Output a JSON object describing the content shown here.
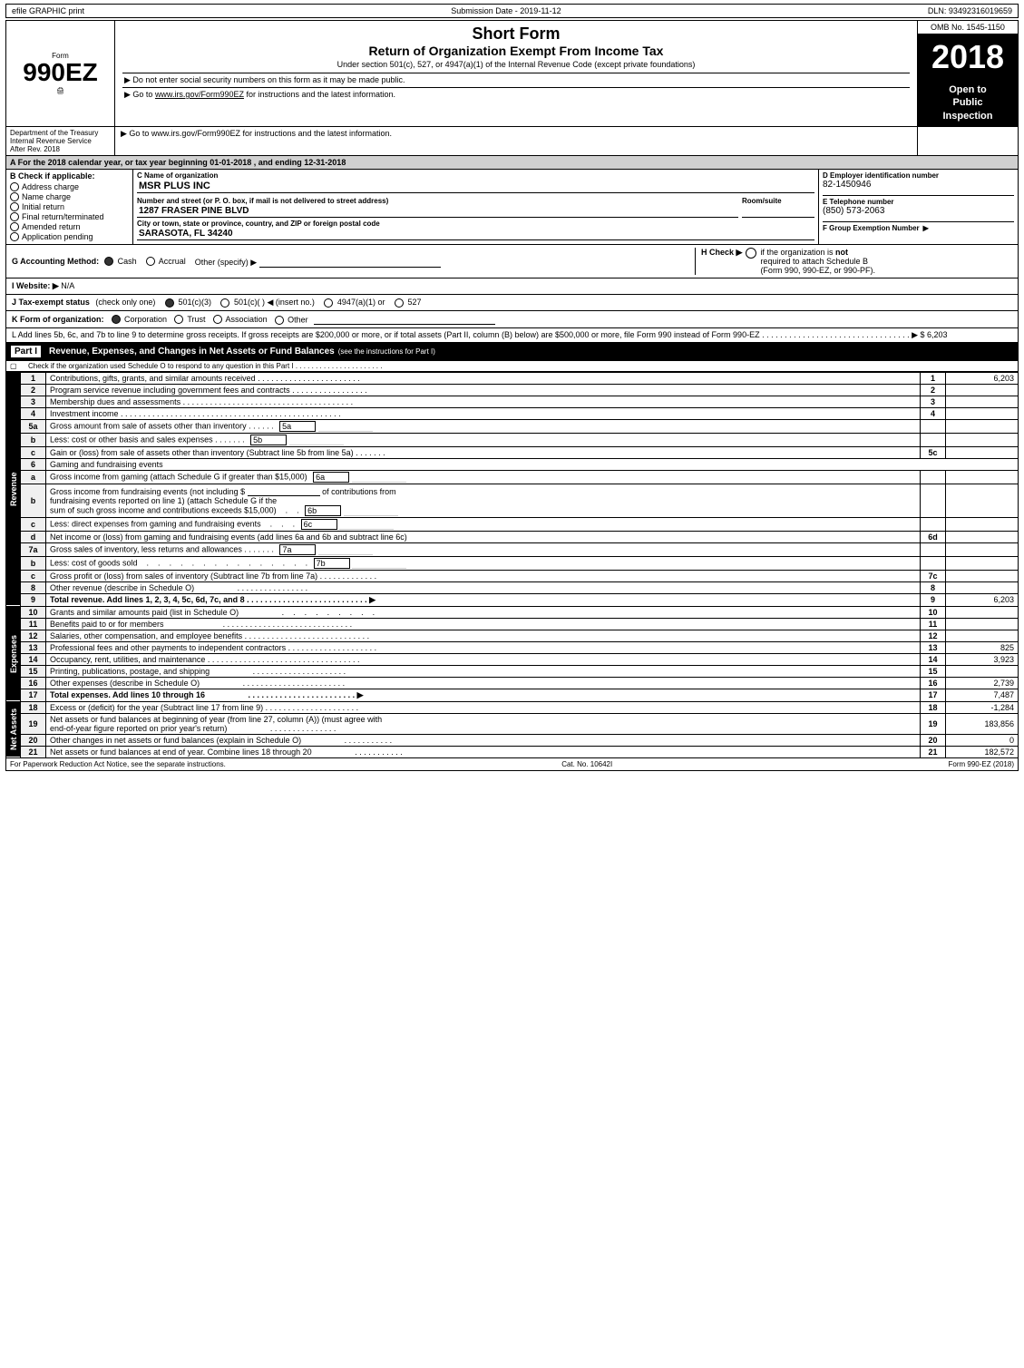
{
  "topBar": {
    "left": "efile GRAPHIC print",
    "middle": "Submission Date - 2019-11-12",
    "right": "DLN: 93492316019659"
  },
  "header": {
    "formLabel": "Form",
    "formNumber": "990EZ",
    "shortFormTitle": "Short Form",
    "returnTitle": "Return of Organization Exempt From Income Tax",
    "subtitle": "Under section 501(c), 527, or 4947(a)(1) of the Internal Revenue Code (except private foundations)",
    "publicNotice": "▶ Do not enter social security numbers on this form as it may be made public.",
    "instructions": "▶ Go to www.irs.gov/Form990EZ for instructions and the latest information.",
    "year": "2018",
    "openToPublic": [
      "Open to",
      "Public",
      "Inspection"
    ],
    "ombNumber": "OMB No. 1545-1150"
  },
  "department": {
    "name": "Department of the Treasury",
    "afterRevDate": "After Rev. 2018",
    "websiteNote": "▶ Go to www.irs.gov/Form990EZ for instructions and the latest information."
  },
  "yearLine": {
    "text": "A For the 2018 calendar year, or tax year beginning 01-01-2018        , and ending 12-31-2018"
  },
  "checkSection": {
    "label": "B Check if applicable:",
    "items": [
      {
        "id": "address",
        "label": "Address charge",
        "checked": false
      },
      {
        "id": "name",
        "label": "Name charge",
        "checked": false
      },
      {
        "id": "initial",
        "label": "Initial return",
        "checked": false
      },
      {
        "id": "final",
        "label": "Final return/terminated",
        "checked": false
      },
      {
        "id": "amended",
        "label": "Amended return",
        "checked": false
      },
      {
        "id": "pending",
        "label": "Application pending",
        "checked": false
      }
    ],
    "cLabel": "C Name of organization",
    "orgName": "MSR PLUS INC",
    "addressLabel": "Number and street (or P. O. box, if mail is not delivered to street address)",
    "addressValue": "1287 FRASER PINE BLVD",
    "roomSuiteLabel": "Room/suite",
    "cityLabel": "City or town, state or province, country, and ZIP or foreign postal code",
    "cityValue": "SARASOTA, FL  34240",
    "dLabel": "D Employer identification number",
    "ein": "82-1450946",
    "eLabel": "E Telephone number",
    "phone": "(850) 573-2063",
    "fLabel": "F Group Exemption Number",
    "fArrow": "▶"
  },
  "accountingMethod": {
    "label": "G Accounting Method:",
    "cash": "Cash",
    "accrual": "Accrual",
    "other": "Other (specify) ▶",
    "cashSelected": true,
    "hLabel": "H Check ▶",
    "hText1": "if the organization is",
    "hBold": "not",
    "hText2": "required to attach Schedule B",
    "hText3": "(Form 990, 990-EZ, or 990-PF)."
  },
  "website": {
    "label": "I Website: ▶",
    "value": "N/A"
  },
  "taxStatus": {
    "label": "J Tax-exempt status",
    "note": "(check only one)",
    "options": [
      {
        "value": "501(c)(3)",
        "selected": true
      },
      {
        "value": "501(c)(  )",
        "selected": false,
        "insertNo": "(insert no.)"
      },
      {
        "value": "4947(a)(1) or",
        "selected": false
      },
      {
        "value": "527",
        "selected": false
      }
    ]
  },
  "formOrg": {
    "label": "K Form of organization:",
    "options": [
      {
        "value": "Corporation",
        "selected": true
      },
      {
        "value": "Trust",
        "selected": false
      },
      {
        "value": "Association",
        "selected": false
      },
      {
        "value": "Other",
        "selected": false
      }
    ]
  },
  "lText": "L Add lines 5b, 6c, and 7b to line 9 to determine gross receipts. If gross receipts are $200,000 or more, or if total assets (Part II, column (B) below) are $500,000 or more, file Form 990 instead of Form 990-EZ . . . . . . . . . . . . . . . . . . . . . . . . . . . . . . . . . ▶ $ 6,203",
  "partI": {
    "label": "Part I",
    "title": "Revenue, Expenses, and Changes in Net Assets or Fund Balances",
    "titleNote": "(see the instructions for Part I)",
    "schedCheckText": "Check if the organization used Schedule O to respond to any question in this Part I . . . . . . . . . . . . . . . . . . . . . .",
    "schedCheckBox": "▢",
    "rows": [
      {
        "num": "1",
        "desc": "Contributions, gifts, grants, and similar amounts received . . . . . . . . . . . . . . . . . . . . . . .",
        "lineNum": "1",
        "amount": "6,203"
      },
      {
        "num": "2",
        "desc": "Program service revenue including government fees and contracts . . . . . . . . . . . . . . . . .",
        "lineNum": "2",
        "amount": ""
      },
      {
        "num": "3",
        "desc": "Membership dues and assessments . . . . . . . . . . . . . . . . . . . . . . . . . . . . . . . . . . . . . .",
        "lineNum": "3",
        "amount": ""
      },
      {
        "num": "4",
        "desc": "Investment income . . . . . . . . . . . . . . . . . . . . . . . . . . . . . . . . . . . . . . . . . . . . . . . . .",
        "lineNum": "4",
        "amount": ""
      },
      {
        "num": "5a",
        "desc": "Gross amount from sale of assets other than inventory . . . . . .",
        "lineNum": "5a",
        "amount": "",
        "hasInlineBox": true
      },
      {
        "num": "5b",
        "desc": "Less: cost or other basis and sales expenses . . . . . . . .",
        "lineNum": "5b",
        "amount": "",
        "hasInlineBox": true
      },
      {
        "num": "5c",
        "desc": "Gain or (loss) from sale of assets other than inventory (Subtract line 5b from line 5a) . . . . . . .",
        "lineNum": "5c",
        "amount": ""
      },
      {
        "num": "6",
        "desc": "Gaming and fundraising events",
        "lineNum": "",
        "amount": "",
        "noAmount": true
      },
      {
        "num": "6a",
        "desc": "Gross income from gaming (attach Schedule G if greater than $15,000)",
        "lineNum": "6a",
        "amount": "",
        "hasInlineBox": true
      },
      {
        "num": "6b",
        "desc": "Gross income from fundraising events (not including $ ______________ of contributions from fundraising events reported on line 1) (attach Schedule G if the sum of such gross income and contributions exceeds $15,000)     .     .",
        "lineNum": "6b",
        "amount": "",
        "hasInlineBox": true
      },
      {
        "num": "6c",
        "desc": "Less: direct expenses from gaming and fundraising events     .     .     .",
        "lineNum": "6c",
        "amount": "",
        "hasInlineBox": true
      },
      {
        "num": "6d",
        "desc": "Net income or (loss) from gaming and fundraising events (add lines 6a and 6b and subtract line 6c)",
        "lineNum": "6d",
        "amount": ""
      },
      {
        "num": "7a",
        "desc": "Gross sales of inventory, less returns and allowances . . . . . . . .",
        "lineNum": "7a",
        "amount": "",
        "hasInlineBox": true
      },
      {
        "num": "7b",
        "desc": "Less: cost of goods sold     .     .     .     .     .     .     .     .     .     .     .     .     .     .     .",
        "lineNum": "7b",
        "amount": "",
        "hasInlineBox": true
      },
      {
        "num": "7c",
        "desc": "Gross profit or (loss) from sales of inventory (Subtract line 7b from line 7a) . . . . . . . . . . . . .",
        "lineNum": "7c",
        "amount": ""
      },
      {
        "num": "8",
        "desc": "Other revenue (describe in Schedule O)                               . . . . . . . . . . . . . . . .",
        "lineNum": "8",
        "amount": ""
      },
      {
        "num": "9",
        "desc": "Total revenue. Add lines 1, 2, 3, 4, 5c, 6d, 7c, and 8 . . . . . . . . . . . . . . . . . . . . . . . . . . ▶",
        "lineNum": "9",
        "amount": "6,203",
        "bold": true
      }
    ],
    "expenseRows": [
      {
        "num": "10",
        "desc": "Grants and similar amounts paid (list in Schedule O)                               .     .     .     .     .     .     .     .     .     .",
        "lineNum": "10",
        "amount": ""
      },
      {
        "num": "11",
        "desc": "Benefits paid to or for members                               . . . . . . . . . . . . . . . . . . . . . . . . . . . . .",
        "lineNum": "11",
        "amount": ""
      },
      {
        "num": "12",
        "desc": "Salaries, other compensation, and employee benefits . . . . . . . . . . . . . . . . . . . . . . . . . . . .",
        "lineNum": "12",
        "amount": ""
      },
      {
        "num": "13",
        "desc": "Professional fees and other payments to independent contractors . . . . . . . . . . . . . . . . . . . .",
        "lineNum": "13",
        "amount": "825"
      },
      {
        "num": "14",
        "desc": "Occupancy, rent, utilities, and maintenance . . . . . . . . . . . . . . . . . . . . . . . . . . . . . . . . . .",
        "lineNum": "14",
        "amount": "3,923"
      },
      {
        "num": "15",
        "desc": "Printing, publications, postage, and shipping                               . . . . . . . . . . . . . . . . . . . . . .",
        "lineNum": "15",
        "amount": ""
      },
      {
        "num": "16",
        "desc": "Other expenses (describe in Schedule O)                               . . . . . . . . . . . . . . . . . . . . . . .",
        "lineNum": "16",
        "amount": "2,739"
      },
      {
        "num": "17",
        "desc": "Total expenses. Add lines 10 through 16                               . . . . . . . . . . . . . . . . . . . . . . . . ▶",
        "lineNum": "17",
        "amount": "7,487",
        "bold": true
      }
    ],
    "netAssetRows": [
      {
        "num": "18",
        "desc": "Excess or (deficit) for the year (Subtract line 17 from line 9) . . . . . . . . . . . . . . . . . . . . .",
        "lineNum": "18",
        "amount": "-1,284"
      },
      {
        "num": "19",
        "desc": "Net assets or fund balances at beginning of year (from line 27, column (A)) (must agree with end-of-year figure reported on prior year's return)                               . . . . . . . . . . . . . . .",
        "lineNum": "19",
        "amount": "183,856"
      },
      {
        "num": "20",
        "desc": "Other changes in net assets or fund balances (explain in Schedule O)                               . . . . . . . . . . . .",
        "lineNum": "20",
        "amount": "0"
      },
      {
        "num": "21",
        "desc": "Net assets or fund balances at end of year. Combine lines 18 through 20                               . . . . . . . . . . . .",
        "lineNum": "21",
        "amount": "182,572"
      }
    ]
  },
  "footer": {
    "left": "For Paperwork Reduction Act Notice, see the separate instructions.",
    "cat": "Cat. No. 10642I",
    "right": "Form 990-EZ (2018)"
  }
}
